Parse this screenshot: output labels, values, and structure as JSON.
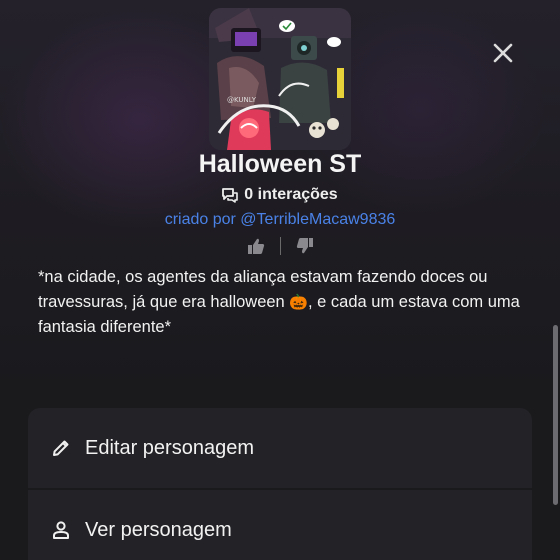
{
  "character": {
    "name": "Halloween ST",
    "interactions": "0 interações",
    "creator": "criado por @TerribleMacaw9836",
    "description_part1": "*na cidade, os agentes da aliança estavam fazendo doces ou travessuras, já que era halloween ",
    "description_emoji": "🎃",
    "description_part2": ", e cada um estava com uma fantasia diferente*",
    "avatar_signature": "@KUNLY"
  },
  "menu": {
    "edit_label": "Editar personagem",
    "view_label": "Ver personagem"
  },
  "icons": {
    "close": "close-icon",
    "chat": "chat-bubbles-icon",
    "like": "thumbs-up-icon",
    "dislike": "thumbs-down-icon",
    "edit": "pencil-icon",
    "view": "person-icon"
  },
  "colors": {
    "background": "#1a1a1d",
    "card": "#232327",
    "link": "#4a82e8",
    "text": "#f2f2f2"
  }
}
